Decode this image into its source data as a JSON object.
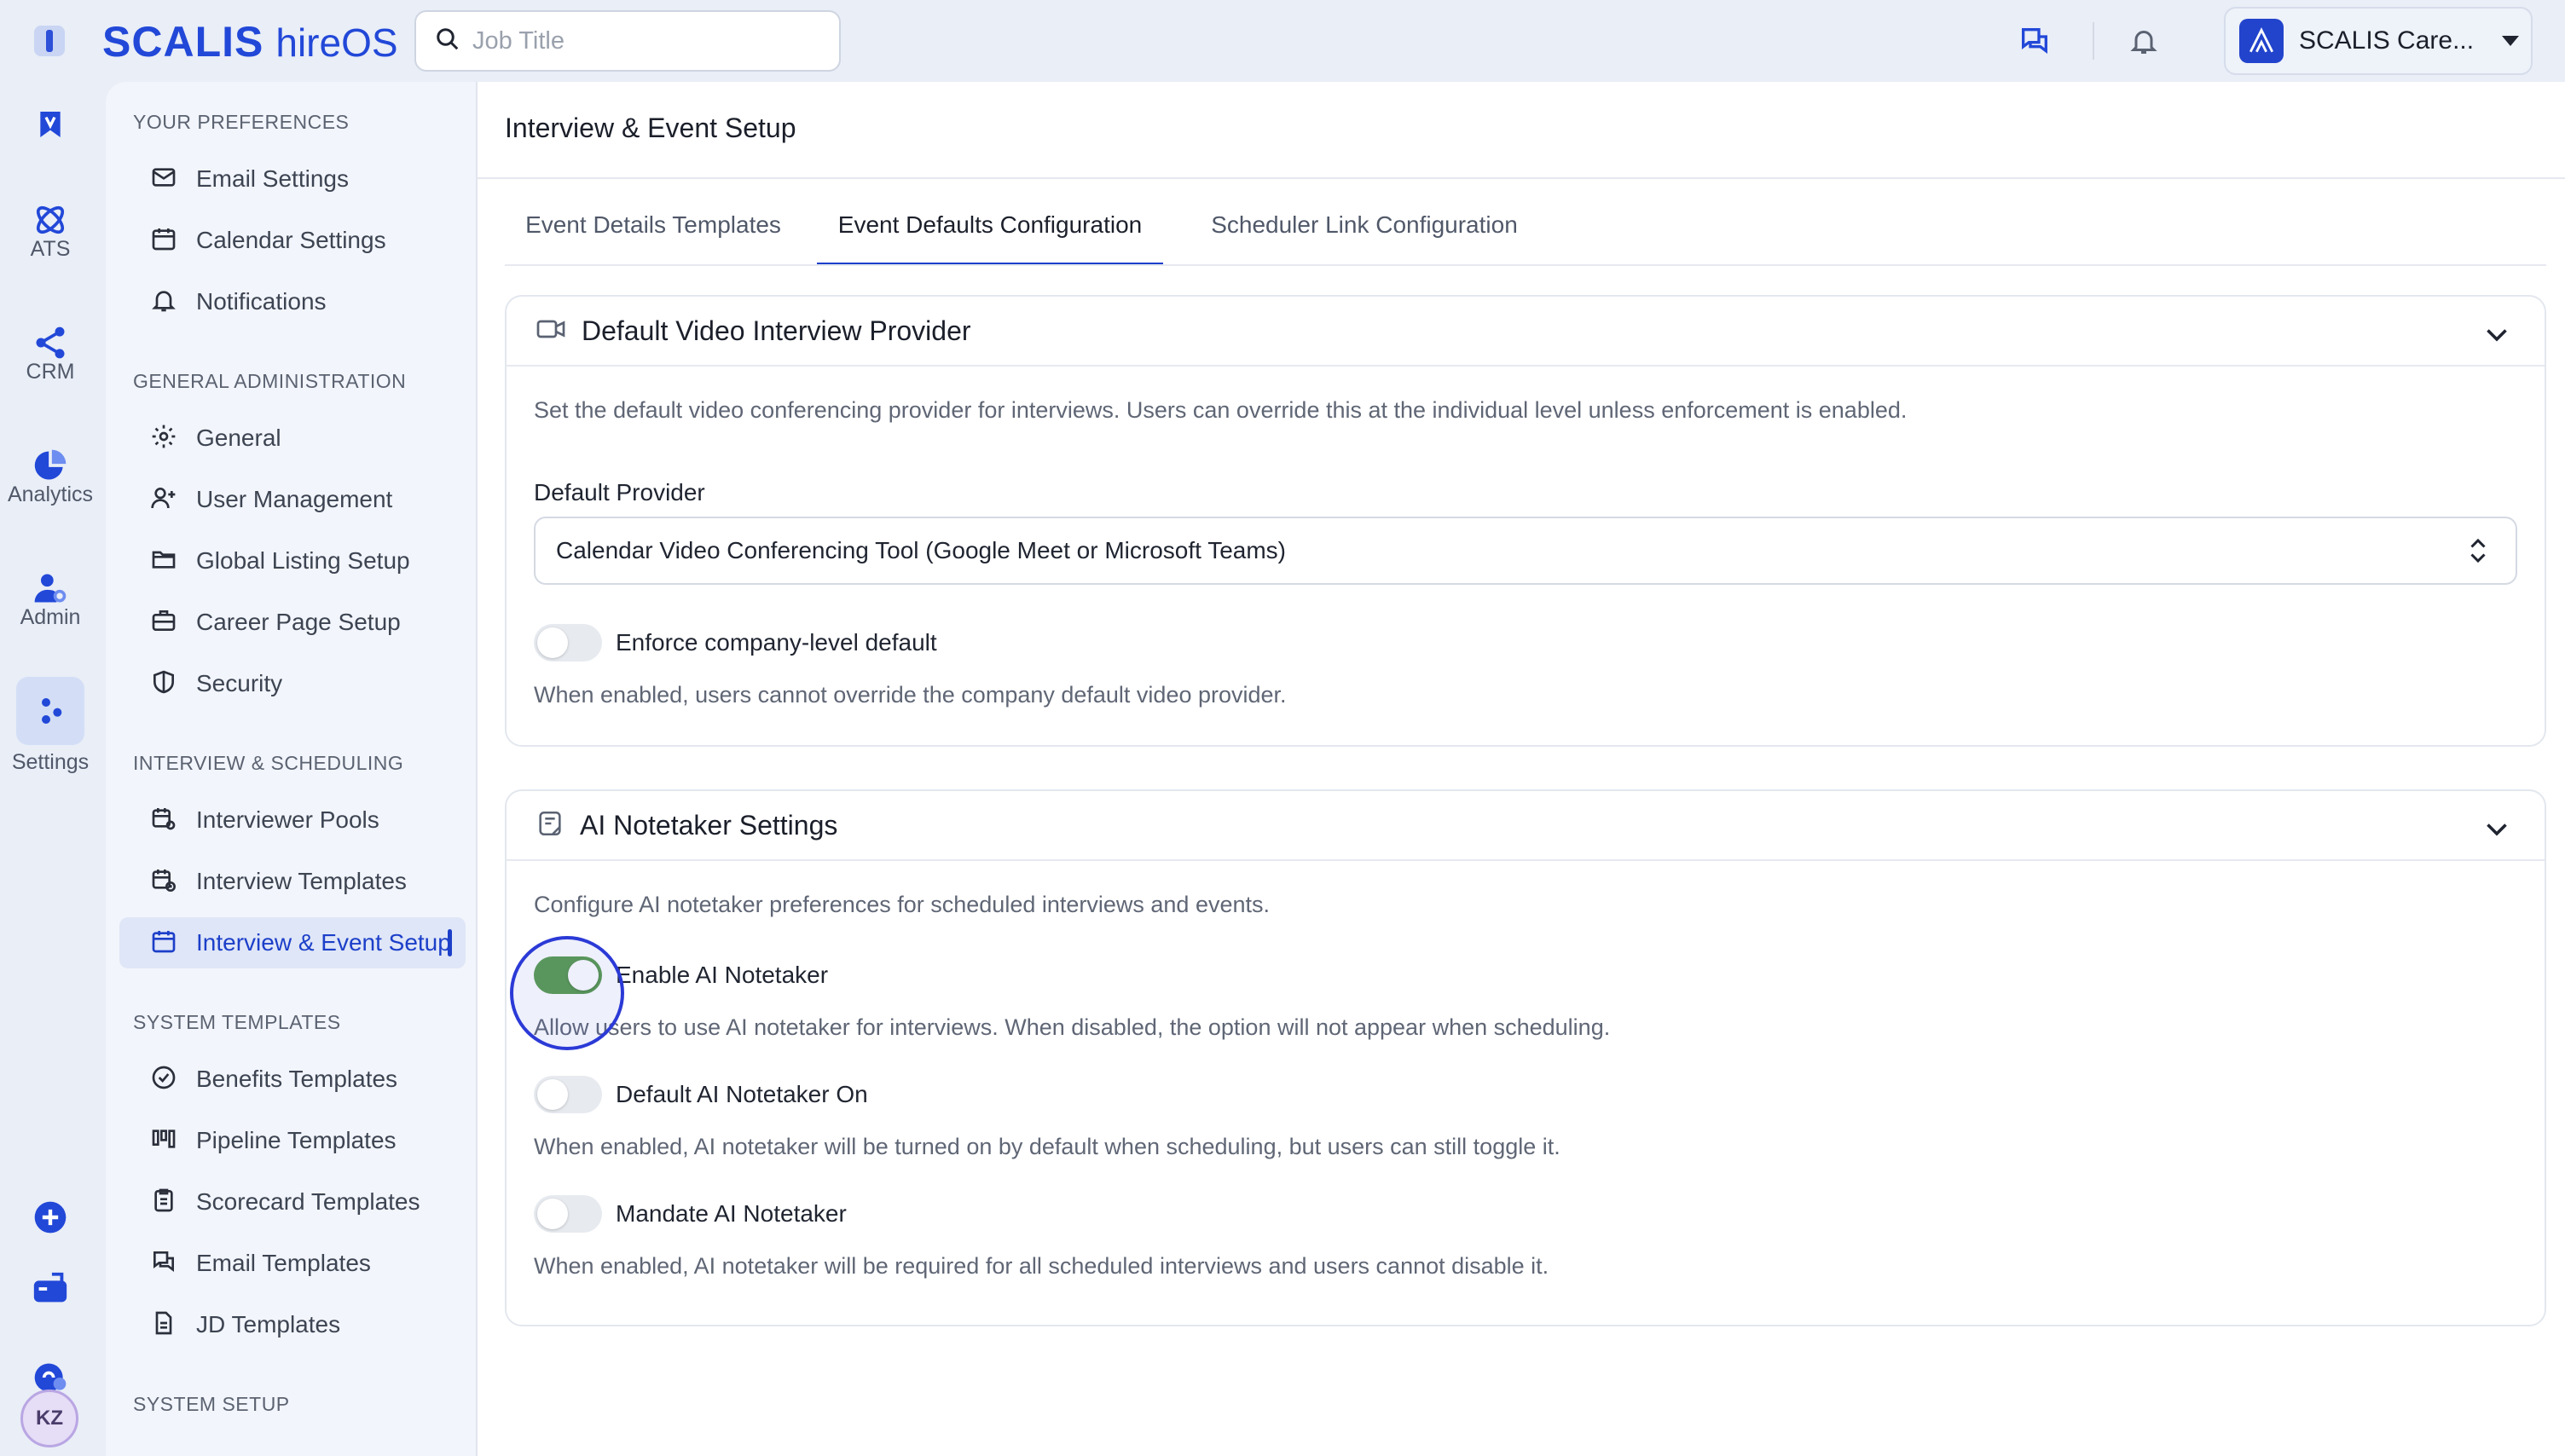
{
  "brand": {
    "main": "SCALIS",
    "sub": "hireOS"
  },
  "search": {
    "placeholder": "Job Title"
  },
  "company": {
    "name": "SCALIS Care..."
  },
  "rail": {
    "ats": "ATS",
    "crm": "CRM",
    "analytics": "Analytics",
    "admin": "Admin",
    "settings": "Settings",
    "avatar": "KZ"
  },
  "sidebar": {
    "groups": [
      {
        "title": "YOUR PREFERENCES",
        "items": [
          "Email Settings",
          "Calendar Settings",
          "Notifications"
        ]
      },
      {
        "title": "GENERAL ADMINISTRATION",
        "items": [
          "General",
          "User Management",
          "Global Listing Setup",
          "Career Page Setup",
          "Security"
        ]
      },
      {
        "title": "INTERVIEW & SCHEDULING",
        "items": [
          "Interviewer Pools",
          "Interview Templates",
          "Interview & Event Setup"
        ]
      },
      {
        "title": "SYSTEM TEMPLATES",
        "items": [
          "Benefits Templates",
          "Pipeline Templates",
          "Scorecard Templates",
          "Email Templates",
          "JD Templates"
        ]
      },
      {
        "title": "SYSTEM SETUP",
        "items": []
      }
    ],
    "active_item": "Interview & Event Setup"
  },
  "main": {
    "title": "Interview & Event Setup",
    "tabs": [
      "Event Details Templates",
      "Event Defaults Configuration",
      "Scheduler Link Configuration"
    ],
    "active_tab": "Event Defaults Configuration",
    "video_card": {
      "title": "Default Video Interview Provider",
      "description": "Set the default video conferencing provider for interviews. Users can override this at the individual level unless enforcement is enabled.",
      "provider_label": "Default Provider",
      "provider_value": "Calendar Video Conferencing Tool (Google Meet or Microsoft Teams)",
      "enforce_label": "Enforce company-level default",
      "enforce_on": false,
      "enforce_help": "When enabled, users cannot override the company default video provider."
    },
    "ai_card": {
      "title": "AI Notetaker Settings",
      "description": "Configure AI notetaker preferences for scheduled interviews and events.",
      "enable_label": "Enable AI Notetaker",
      "enable_on": true,
      "enable_help": "Allow users to use AI notetaker for interviews. When disabled, the option will not appear when scheduling.",
      "default_label": "Default AI Notetaker On",
      "default_on": false,
      "default_help": "When enabled, AI notetaker will be turned on by default when scheduling, but users can still toggle it.",
      "mandate_label": "Mandate AI Notetaker",
      "mandate_on": false,
      "mandate_help": "When enabled, AI notetaker will be required for all scheduled interviews and users cannot disable it."
    }
  },
  "colors": {
    "brand": "#2248d8",
    "accent": "#1c3fc9",
    "toggle_on": "#5a9b4e"
  }
}
